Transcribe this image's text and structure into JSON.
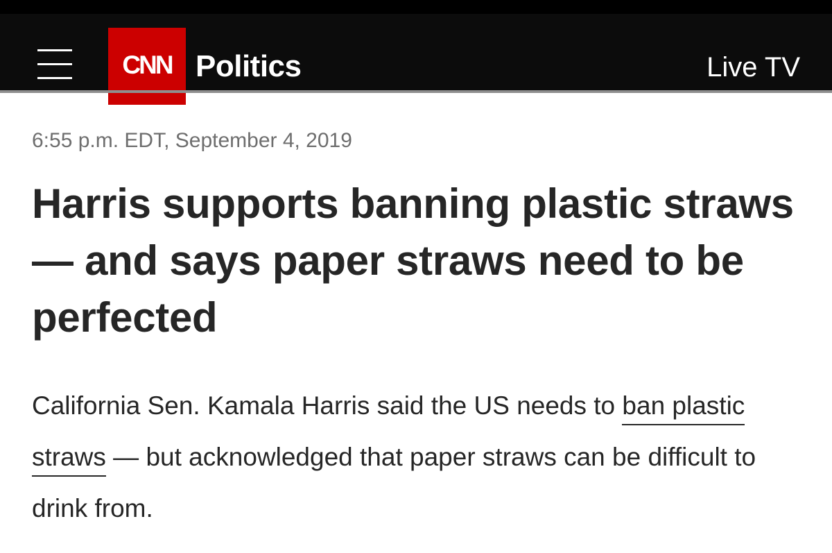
{
  "header": {
    "logo_text": "CNN",
    "section": "Politics",
    "live_tv": "Live TV"
  },
  "article": {
    "timestamp": "6:55 p.m. EDT, September 4, 2019",
    "headline": "Harris supports banning plastic straws — and says paper straws need to be perfected",
    "body_before_link": "California Sen. Kamala Harris said the US needs to ",
    "link_text": "ban plastic straws",
    "body_after_link": " — but acknowledged that paper straws can be difficult to drink from."
  },
  "colors": {
    "header_bg": "#0c0c0c",
    "logo_red": "#cc0000",
    "text": "#262626",
    "timestamp": "#6e6e6e"
  },
  "icons": {
    "menu": "hamburger-menu-icon"
  }
}
